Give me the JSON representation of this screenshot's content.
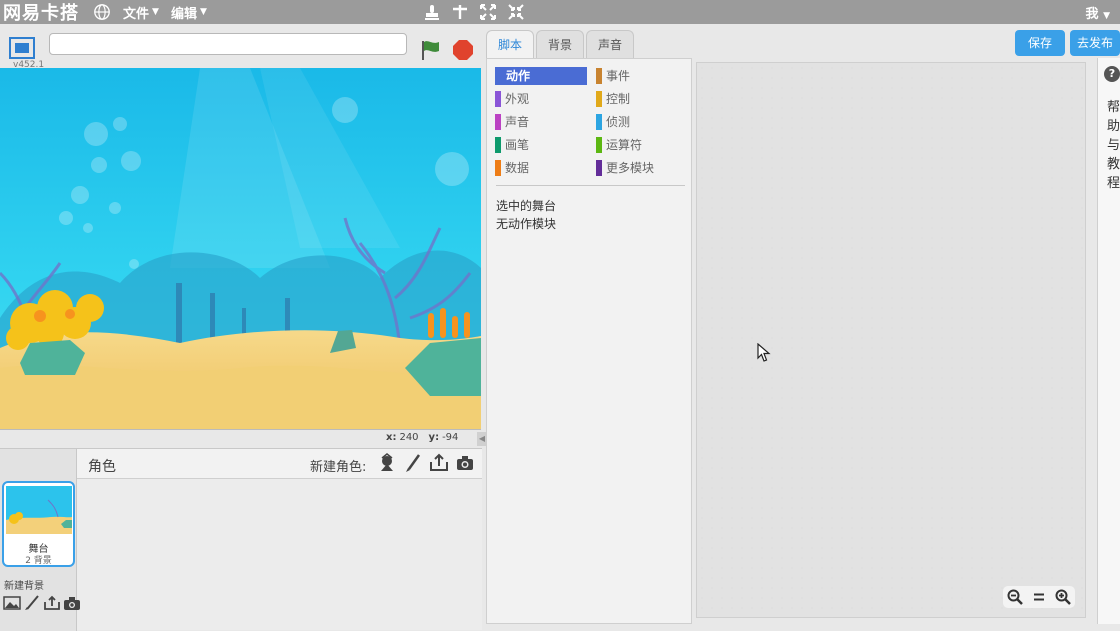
{
  "topbar": {
    "brand": "网易卡搭",
    "menus": [
      {
        "label": "文件"
      },
      {
        "label": "编辑"
      }
    ],
    "user_label": "我",
    "icons": [
      "globe-icon",
      "duplicate-stamp-icon",
      "cut-icon",
      "grow-icon",
      "shrink-icon"
    ]
  },
  "stage": {
    "version": "v452.1",
    "project_title": "",
    "coords": {
      "x_label": "x:",
      "x_value": "240",
      "y_label": "y:",
      "y_value": "-94"
    }
  },
  "sprites": {
    "title": "角色",
    "new_sprite_label": "新建角色:",
    "stage_thumb": {
      "name": "舞台",
      "sub": "2 背景"
    },
    "new_backdrop_label": "新建背景"
  },
  "tabs": [
    {
      "label": "脚本",
      "active": true
    },
    {
      "label": "背景",
      "active": false
    },
    {
      "label": "声音",
      "active": false
    }
  ],
  "actions": {
    "save": "保存",
    "publish": "去发布"
  },
  "palette": {
    "categories": [
      {
        "label": "动作",
        "color": "#4a6cd4",
        "selected": true
      },
      {
        "label": "外观",
        "color": "#8a55d7"
      },
      {
        "label": "声音",
        "color": "#bb42c3"
      },
      {
        "label": "画笔",
        "color": "#0e9a6c"
      },
      {
        "label": "数据",
        "color": "#ee7d16"
      },
      {
        "label": "事件",
        "color": "#c88330"
      },
      {
        "label": "控制",
        "color": "#e1a91a"
      },
      {
        "label": "侦测",
        "color": "#2ca5e2"
      },
      {
        "label": "运算符",
        "color": "#5cb712"
      },
      {
        "label": "更多模块",
        "color": "#632d99"
      }
    ],
    "message_line1": "选中的舞台",
    "message_line2": "无动作模块"
  },
  "help": {
    "text": "帮助与教程"
  }
}
